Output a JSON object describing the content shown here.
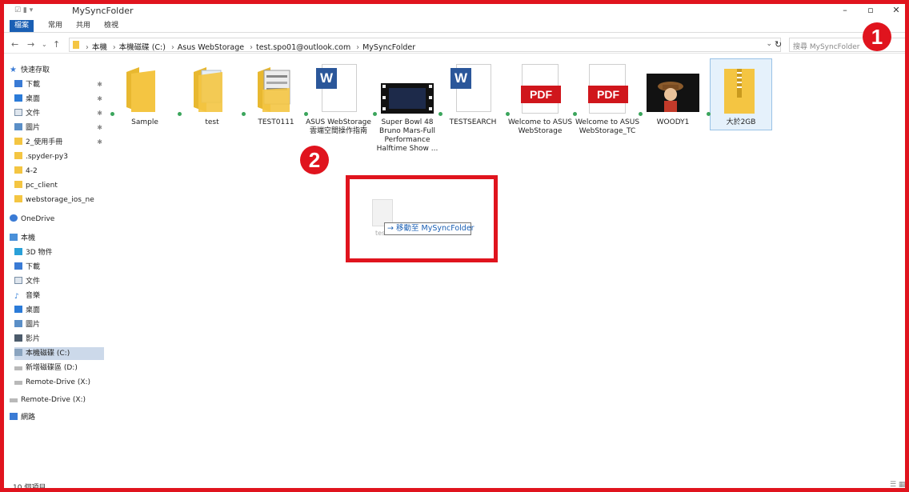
{
  "window": {
    "title": "MySyncFolder"
  },
  "ribbon": {
    "tabs": [
      "檔案",
      "常用",
      "共用",
      "檢視"
    ]
  },
  "address": {
    "crumbs": [
      "本機",
      "本機磁碟 (C:)",
      "Asus WebStorage",
      "test.spo01@outlook.com",
      "MySyncFolder"
    ],
    "search_placeholder": "搜尋 MySyncFolder"
  },
  "nav": {
    "quick_access": "快速存取",
    "quick_items": [
      "下載",
      "桌面",
      "文件",
      "圖片",
      "2_使用手冊",
      ".spyder-py3",
      "4-2",
      "pc_client",
      "webstorage_ios_ne"
    ],
    "onedrive": "OneDrive",
    "this_pc": "本機",
    "pc_items": [
      "3D 物件",
      "下載",
      "文件",
      "音樂",
      "桌面",
      "圖片",
      "影片",
      "本機磁碟 (C:)",
      "新增磁碟區 (D:)",
      "Remote-Drive (X:)"
    ],
    "remote": "Remote-Drive (X:)",
    "network": "網路"
  },
  "files": [
    {
      "name": "Sample",
      "kind": "folder"
    },
    {
      "name": "test",
      "kind": "folder-docs"
    },
    {
      "name": "TEST0111",
      "kind": "folder-docs"
    },
    {
      "name": "ASUS WebStorage 雲端空間操作指南",
      "kind": "word"
    },
    {
      "name": "Super Bowl 48 Bruno Mars-Full Performance Halftime Show ...",
      "kind": "video"
    },
    {
      "name": "TESTSEARCH",
      "kind": "word"
    },
    {
      "name": "Welcome to ASUS WebStorage",
      "kind": "pdf"
    },
    {
      "name": "Welcome to ASUS WebStorage_TC",
      "kind": "pdf"
    },
    {
      "name": "WOODY1",
      "kind": "image"
    },
    {
      "name": "大於2GB",
      "kind": "zip"
    }
  ],
  "pdf_label": "PDF",
  "word_letter": "W",
  "drag": {
    "ghost_label": "test",
    "tooltip": "→ 移動至 MySyncFolder"
  },
  "badges": {
    "one": "1",
    "two": "2"
  },
  "status": {
    "count": "10 個項目"
  },
  "colors": {
    "accent": "#1a5fb4",
    "annotation": "#e0141e",
    "folder": "#f4c542",
    "sync_dot": "#3ba55c"
  }
}
